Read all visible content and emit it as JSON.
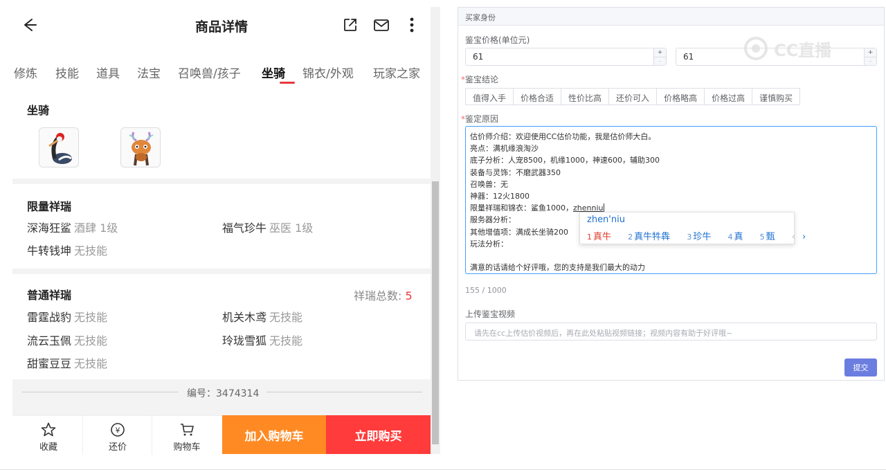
{
  "left": {
    "header": {
      "title": "商品详情"
    },
    "tabs": [
      {
        "label": "修炼"
      },
      {
        "label": "技能"
      },
      {
        "label": "道具"
      },
      {
        "label": "法宝"
      },
      {
        "label": "召唤兽/孩子"
      },
      {
        "label": "坐骑"
      },
      {
        "label": "锦衣/外观"
      },
      {
        "label": "玩家之家"
      }
    ],
    "active_tab": "坐骑",
    "mounts": {
      "title": "坐骑"
    },
    "limited": {
      "title": "限量祥瑞",
      "items": [
        {
          "name": "深海狂鲨",
          "skill": "酒肆 1级"
        },
        {
          "name": "福气珍牛",
          "skill": "巫医 1级"
        },
        {
          "name": "牛转钱坤",
          "skill": "无技能"
        }
      ]
    },
    "normal": {
      "title": "普通祥瑞",
      "total_label": "祥瑞总数:",
      "total": "5",
      "items": [
        {
          "name": "雷霆战豹",
          "skill": "无技能"
        },
        {
          "name": "机关木鸢",
          "skill": "无技能"
        },
        {
          "name": "流云玉佩",
          "skill": "无技能"
        },
        {
          "name": "玲珑雪狐",
          "skill": "无技能"
        },
        {
          "name": "甜蜜豆豆",
          "skill": "无技能"
        }
      ]
    },
    "serial": "编号：3474314",
    "bottom_bar": {
      "favorite": "收藏",
      "bargain": "还价",
      "cart": "购物车",
      "bargain_icon": "¥",
      "add_to_cart": "加入购物车",
      "buy_now": "立即购买"
    }
  },
  "right": {
    "panel_title": "买家身份",
    "price_label": "鉴宝价格(单位元)",
    "price_min": "61",
    "price_max": "61",
    "spin_plus": "+",
    "spin_minus": "-",
    "required_mark": "*",
    "conclusion_label": "鉴宝结论",
    "conclusions": [
      "值得入手",
      "价格合适",
      "性价比高",
      "还价可入",
      "价格略高",
      "价格过高",
      "谨慎购买"
    ],
    "reason_label": "鉴定原因",
    "reason_lines": [
      "估价师介绍：欢迎使用CC估价功能，我是估价师大白。",
      "亮点：满机缘浪淘沙",
      "底子分析：人宠8500，机缘1000，神速600，辅助300",
      "装备与灵饰：不磨武器350",
      "召唤兽：无",
      "神器：12火1800",
      "限量祥瑞和锦衣：鲨鱼1000，",
      "服务器分析：",
      "其他增值项：满成长坐骑200",
      "玩法分析：",
      "",
      "满意的话请给个好评哦，您的支持是我们最大的动力"
    ],
    "typing": "zhenniu",
    "ime": {
      "pinyin": "zhen'niu",
      "candidates": [
        {
          "n": "1",
          "text": "真牛"
        },
        {
          "n": "2",
          "text": "真牛牪犇"
        },
        {
          "n": "3",
          "text": "珍牛"
        },
        {
          "n": "4",
          "text": "真"
        },
        {
          "n": "5",
          "text": "甄"
        }
      ],
      "prev": "‹",
      "next": "›"
    },
    "counter": "155 / 1000",
    "video_label": "上传鉴宝视频",
    "video_placeholder": "请先在cc上传估价视频后，再在此处粘贴视频链接；视频内容有助于好评哦~",
    "submit": "提交",
    "watermark": "CC直播"
  }
}
